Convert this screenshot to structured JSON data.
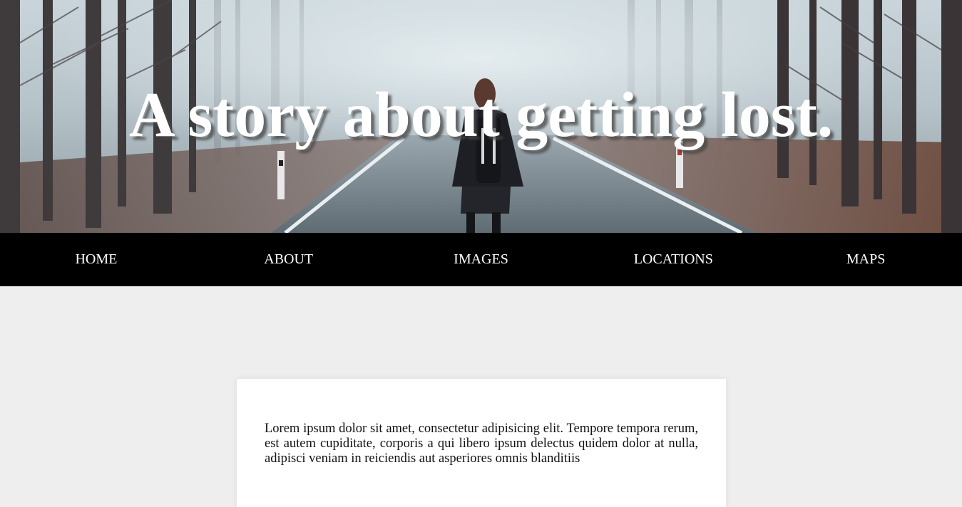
{
  "hero": {
    "title": "A story about getting lost.",
    "image_subject": "person-standing-on-foggy-forest-road"
  },
  "nav": {
    "items": [
      {
        "label": "HOME"
      },
      {
        "label": "ABOUT"
      },
      {
        "label": "IMAGES"
      },
      {
        "label": "LOCATIONS"
      },
      {
        "label": "MAPS"
      }
    ]
  },
  "content": {
    "paragraph": "Lorem ipsum dolor sit amet, consectetur adipisicing elit. Tempore tempora rerum, est autem cupiditate, corporis a qui libero ipsum delectus quidem dolor at nulla, adipisci veniam in reiciendis aut asperiores omnis blanditiis"
  },
  "colors": {
    "page_background": "#eeeeee",
    "nav_background": "#000000",
    "nav_text": "#ffffff",
    "card_background": "#ffffff",
    "title_text": "#ffffff"
  }
}
